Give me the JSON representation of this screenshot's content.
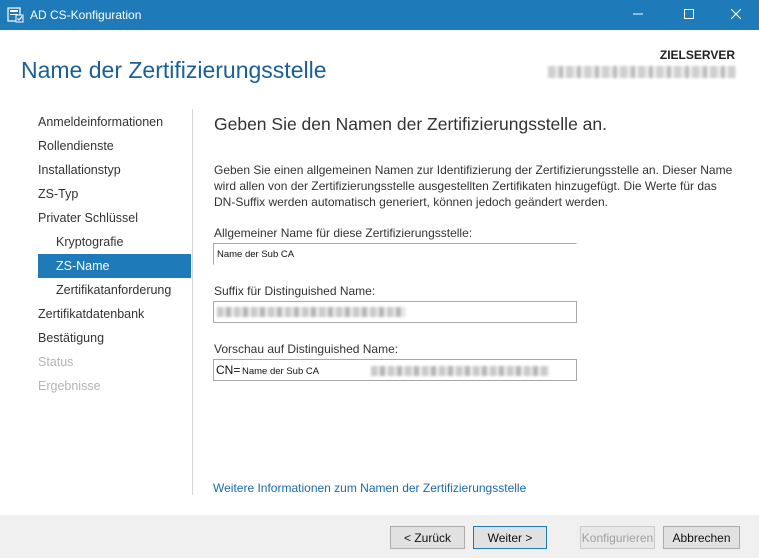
{
  "window": {
    "title": "AD CS-Konfiguration",
    "controls": [
      "minimize-icon",
      "maximize-icon",
      "close-icon"
    ],
    "accent_color": "#1e7ab8"
  },
  "header": {
    "title": "Name der Zertifizierungsstelle",
    "target_label": "ZIELSERVER"
  },
  "sidebar": {
    "items": [
      {
        "label": "Anmeldeinformationen"
      },
      {
        "label": "Rollendienste"
      },
      {
        "label": "Installationstyp"
      },
      {
        "label": "ZS-Typ"
      },
      {
        "label": "Privater Schlüssel"
      },
      {
        "label": "Kryptografie"
      },
      {
        "label": "ZS-Name"
      },
      {
        "label": "Zertifikatanforderung"
      },
      {
        "label": "Zertifikatdatenbank"
      },
      {
        "label": "Bestätigung"
      },
      {
        "label": "Status"
      },
      {
        "label": "Ergebnisse"
      }
    ],
    "selected": "ZS-Name"
  },
  "main": {
    "heading": "Geben Sie den Namen der Zertifizierungsstelle an.",
    "description": "Geben Sie einen allgemeinen Namen zur Identifizierung der Zertifizierungsstelle an. Dieser Name wird allen von der Zertifizierungsstelle ausgestellten Zertifikaten hinzugefügt. Die Werte für das DN-Suffix werden automatisch generiert, können jedoch geändert werden.",
    "common_name_label": "Allgemeiner Name für diese Zertifizierungsstelle:",
    "common_name_value": "Name der Sub CA",
    "suffix_label": "Suffix für Distinguished Name:",
    "preview_label": "Vorschau auf Distinguished Name:",
    "preview_prefix": "CN=",
    "preview_name": "Name der Sub CA",
    "more_info_link": "Weitere Informationen zum Namen der Zertifizierungsstelle"
  },
  "footer": {
    "back_label": "< Zurück",
    "next_label": "Weiter >",
    "configure_label": "Konfigurieren",
    "cancel_label": "Abbrechen"
  }
}
